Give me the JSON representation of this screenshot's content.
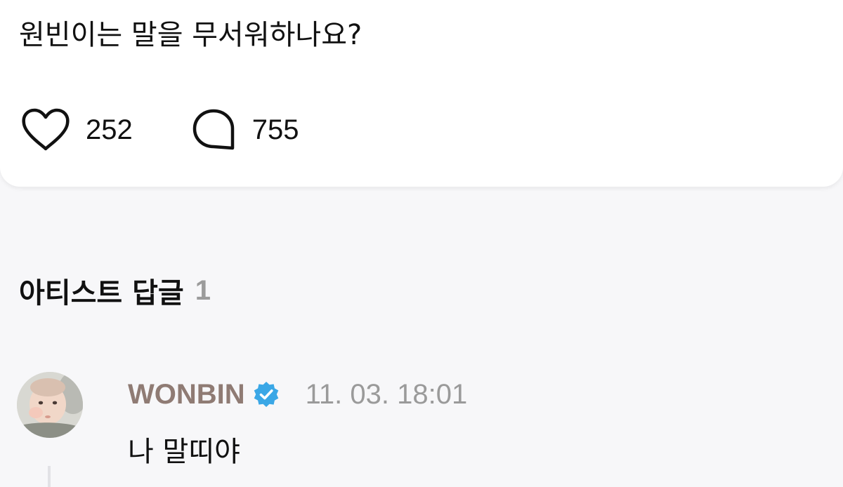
{
  "post": {
    "text": "원빈이는 말을 무서워하나요?",
    "likes": "252",
    "comments": "755",
    "like_icon": "heart-outline-icon",
    "comment_icon": "speech-bubble-icon"
  },
  "artist_replies": {
    "title": "아티스트 답글",
    "count": "1"
  },
  "reply": {
    "author": "WONBIN",
    "timestamp": "11. 03. 18:01",
    "text": "나 말띠야",
    "verified_icon": "verified-badge-icon"
  },
  "colors": {
    "author": "#8f7b74",
    "verified": "#3aa7e6",
    "muted": "#9a9a9a"
  }
}
